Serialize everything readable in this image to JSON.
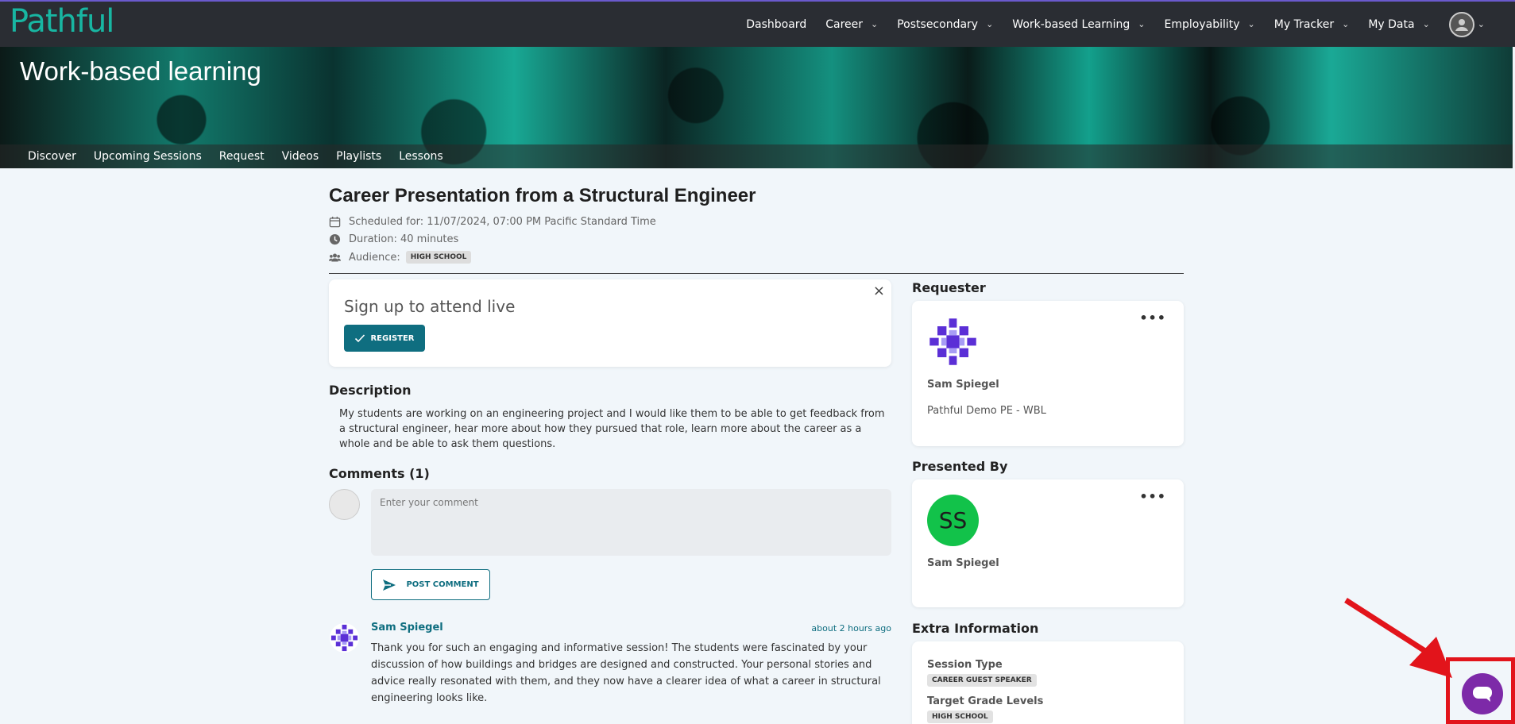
{
  "app": {
    "logo": "Pathful"
  },
  "nav": {
    "items": [
      {
        "label": "Dashboard",
        "dropdown": false
      },
      {
        "label": "Career",
        "dropdown": true
      },
      {
        "label": "Postsecondary",
        "dropdown": true
      },
      {
        "label": "Work-based Learning",
        "dropdown": true
      },
      {
        "label": "Employability",
        "dropdown": true
      },
      {
        "label": "My Tracker",
        "dropdown": true
      },
      {
        "label": "My Data",
        "dropdown": true
      }
    ]
  },
  "banner": {
    "title": "Work-based learning",
    "tabs": [
      "Discover",
      "Upcoming Sessions",
      "Request",
      "Videos",
      "Playlists",
      "Lessons"
    ]
  },
  "session": {
    "title": "Career Presentation from a Structural Engineer",
    "scheduled": "Scheduled for: 11/07/2024, 07:00 PM Pacific Standard Time",
    "duration": "Duration: 40 minutes",
    "audience_label": "Audience:",
    "audience_badge": "HIGH SCHOOL"
  },
  "signup": {
    "title": "Sign up to attend live",
    "close": "×",
    "register_label": "REGISTER"
  },
  "description": {
    "heading": "Description",
    "text": "My students are working on an engineering project and I would like them to be able to get feedback from a structural engineer, hear more about how they pursued that role, learn more about the career as a whole and be able to ask them questions."
  },
  "comments": {
    "heading": "Comments (1)",
    "placeholder": "Enter your comment",
    "post_label": "POST COMMENT",
    "items": [
      {
        "author": "Sam Spiegel",
        "time": "about 2 hours ago",
        "text": "Thank you for such an engaging and informative session! The students were fascinated by your discussion of how buildings and bridges are designed and constructed. Your personal stories and advice really resonated with them, and they now have a clearer idea of what a career in structural engineering looks like."
      }
    ]
  },
  "requester": {
    "heading": "Requester",
    "name": "Sam Spiegel",
    "org": "Pathful Demo PE - WBL",
    "more": "•••"
  },
  "presenter": {
    "heading": "Presented By",
    "initials": "SS",
    "name": "Sam Spiegel",
    "more": "•••"
  },
  "extra": {
    "heading": "Extra Information",
    "session_type_label": "Session Type",
    "session_type": "CAREER GUEST SPEAKER",
    "grade_label": "Target Grade Levels",
    "grade": "HIGH SCHOOL"
  },
  "colors": {
    "topbar": "#2a2d33",
    "brand": "#18b6a2",
    "accent": "#0f6e80",
    "chat": "#7d2aa8",
    "highlight": "#e2141b"
  },
  "icons": [
    "calendar-icon",
    "clock-icon",
    "people-icon",
    "check-icon",
    "send-icon",
    "chat-icon",
    "user-avatar-icon"
  ]
}
